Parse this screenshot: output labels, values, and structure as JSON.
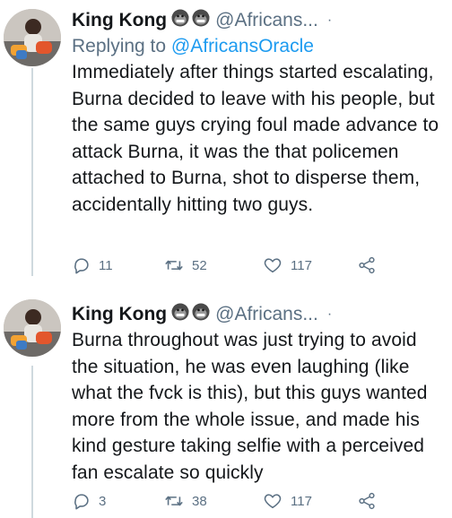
{
  "tweets": [
    {
      "name": "King Kong",
      "emojis": [
        "gorilla-emoji",
        "gorilla-emoji"
      ],
      "handle": "@Africans...",
      "dot": "·",
      "replying_prefix": "Replying to ",
      "replying_to": "@AfricansOracle",
      "text": "Immediately after things started escalating, Burna decided to leave with his people, but the same guys crying foul made advance to attack Burna, it was the that policemen attached to Burna, shot to disperse them, accidentally hitting two guys.",
      "replies": "11",
      "retweets": "52",
      "likes": "117"
    },
    {
      "name": "King Kong",
      "emojis": [
        "gorilla-emoji",
        "gorilla-emoji"
      ],
      "handle": "@Africans...",
      "dot": "·",
      "text": "Burna throughout was just trying to avoid the situation, he was even laughing (like what the fvck is this), but this guys wanted more from the whole issue, and made his kind gesture taking selfie with a perceived fan escalate so quickly",
      "replies": "3",
      "retweets": "38",
      "likes": "117"
    }
  ],
  "icons": [
    "reply-icon",
    "retweet-icon",
    "like-icon",
    "share-icon"
  ],
  "colors": {
    "text": "#14171a",
    "secondary": "#5b7083",
    "link": "#1d9bf0",
    "thread_line": "#cfd9de"
  }
}
